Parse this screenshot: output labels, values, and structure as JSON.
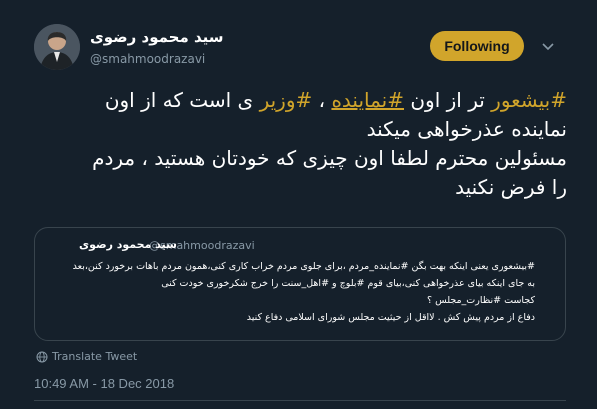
{
  "author": {
    "display_name": "سید محمود رضوی",
    "handle": "@smahmoodrazavi"
  },
  "follow_button": {
    "label": "Following"
  },
  "tweet": {
    "line1_pre": "#بیشعور",
    "line1_mid1": " تر از اون ",
    "line1_tag2": "#نماینده",
    "line1_mid2": " ، ",
    "line1_tag3": "#وزیر",
    "line1_post": " ی است که از اون",
    "line2": "نماینده عذرخواهی میکند",
    "line3": "مسئولین محترم لطفا اون چیزی که خودتان هستید ، مردم",
    "line4": "را فرض نکنید"
  },
  "quoted_tweet": {
    "display_name": "سید محمود رضوی",
    "handle": "@smahmoodrazavi",
    "line1": "#بیشعوری یعنی اینکه بهت بگن #نماینده_مردم ،برای جلوی مردم خراب کاری کنی،همون مردم باهات برخورد کنن،بعد",
    "line2": "به جای اینکه بیای عذرخواهی کنی،بیای قوم #بلوچ و #اهل_سنت را خرج شکرخوری خودت کنی",
    "line3": "کجاست #نظارت_مجلس ؟",
    "line4": "دفاع از مردم پیش کش . لااقل از حیثیت مجلس شورای اسلامی دفاع کنید"
  },
  "translate_link": "Translate Tweet",
  "timestamp": "10:49 AM - 18 Dec 2018",
  "colors": {
    "background": "#15202b",
    "accent": "#d1a52b",
    "secondary_text": "#8899a6",
    "border": "#38444d"
  }
}
